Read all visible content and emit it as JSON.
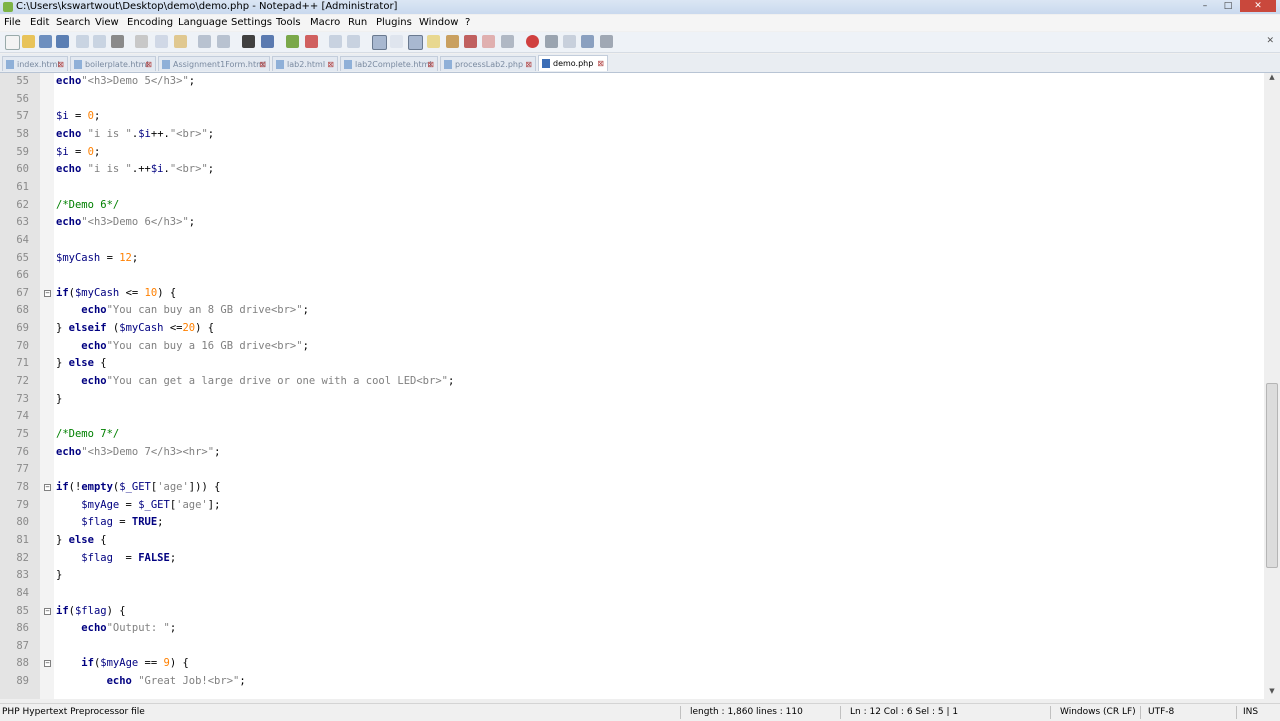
{
  "window": {
    "title": "C:\\Users\\kswartwout\\Desktop\\demo\\demo.php - Notepad++ [Administrator]",
    "controls": [
      "–",
      "□",
      "✕"
    ]
  },
  "menu": [
    "File",
    "Edit",
    "Search",
    "View",
    "Encoding",
    "Language",
    "Settings",
    "Tools",
    "Macro",
    "Run",
    "Plugins",
    "Window",
    "?"
  ],
  "tabs": [
    {
      "label": "index.html"
    },
    {
      "label": "boilerplate.html"
    },
    {
      "label": "Assignment1Form.html"
    },
    {
      "label": "lab2.html"
    },
    {
      "label": "lab2Complete.html"
    },
    {
      "label": "processLab2.php"
    },
    {
      "label": "demo.php"
    }
  ],
  "editor": {
    "lines": [
      {
        "n": "55",
        "code": "echo\"<h3>Demo 5</h3>\";"
      },
      {
        "n": "56",
        "code": ""
      },
      {
        "n": "57",
        "code": "$i = 0;"
      },
      {
        "n": "58",
        "code": "echo \"i is \".$i++.\"<br>\";"
      },
      {
        "n": "59",
        "code": "$i = 0;"
      },
      {
        "n": "60",
        "code": "echo \"i is \".++$i.\"<br>\";"
      },
      {
        "n": "61",
        "code": ""
      },
      {
        "n": "62",
        "code": "/*Demo 6*/"
      },
      {
        "n": "63",
        "code": "echo\"<h3>Demo 6</h3>\";"
      },
      {
        "n": "64",
        "code": ""
      },
      {
        "n": "65",
        "code": "$myCash = 12;"
      },
      {
        "n": "66",
        "code": ""
      },
      {
        "n": "67",
        "code": "if($myCash <= 10) {"
      },
      {
        "n": "68",
        "code": "    echo\"You can buy an 8 GB drive<br>\";"
      },
      {
        "n": "69",
        "code": "} elseif ($myCash <=20) {"
      },
      {
        "n": "70",
        "code": "    echo\"You can buy a 16 GB drive<br>\";"
      },
      {
        "n": "71",
        "code": "} else {"
      },
      {
        "n": "72",
        "code": "    echo\"You can get a large drive or one with a cool LED<br>\";"
      },
      {
        "n": "73",
        "code": "}"
      },
      {
        "n": "74",
        "code": ""
      },
      {
        "n": "75",
        "code": "/*Demo 7*/"
      },
      {
        "n": "76",
        "code": "echo\"<h3>Demo 7</h3><hr>\";"
      },
      {
        "n": "77",
        "code": ""
      },
      {
        "n": "78",
        "code": "if(!empty($_GET['age'])) {"
      },
      {
        "n": "79",
        "code": "    $myAge = $_GET['age'];"
      },
      {
        "n": "80",
        "code": "    $flag = TRUE;"
      },
      {
        "n": "81",
        "code": "} else {"
      },
      {
        "n": "82",
        "code": "    $flag  = FALSE;"
      },
      {
        "n": "83",
        "code": "}"
      },
      {
        "n": "84",
        "code": ""
      },
      {
        "n": "85",
        "code": "if($flag) {"
      },
      {
        "n": "86",
        "code": "    echo\"Output: \";"
      },
      {
        "n": "87",
        "code": ""
      },
      {
        "n": "88",
        "code": "    if($myAge == 9) {"
      },
      {
        "n": "89",
        "code": "        echo \"Great Job!<br>\";"
      }
    ]
  },
  "status": {
    "file_type": "PHP Hypertext Preprocessor file",
    "length": "length : 1,860",
    "lines": "lines : 110",
    "position": "Ln : 12    Col : 6    Sel : 5 | 1",
    "eol": "Windows (CR LF)",
    "encoding": "UTF-8",
    "mode": "INS"
  }
}
